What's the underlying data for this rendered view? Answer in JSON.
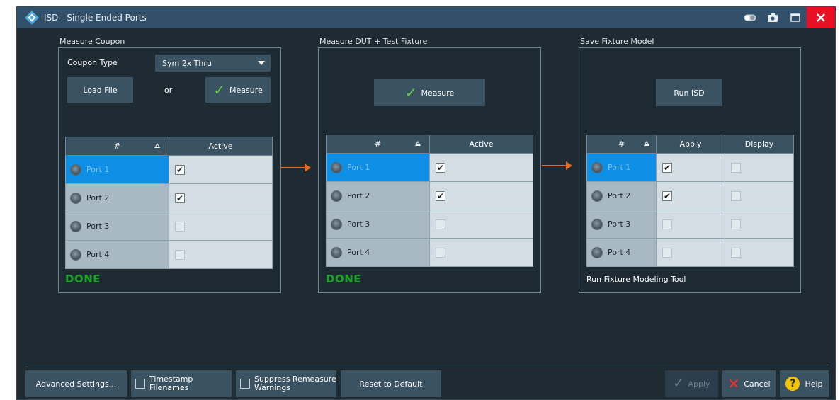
{
  "window": {
    "title": "ISD - Single Ended Ports",
    "colors": {
      "titlebar": "#33506b",
      "background": "#1f2b33",
      "button": "#3a5262",
      "accent_done": "#19a526",
      "flow_arrow": "#e86a1f",
      "selected_row": "#0d8fe5",
      "close": "#e81123"
    }
  },
  "titlebar_icons": [
    "toggle-icon",
    "camera-icon",
    "maximize-icon",
    "close-icon"
  ],
  "measure_coupon": {
    "group_label": "Measure Coupon",
    "coupon_type_label": "Coupon Type",
    "coupon_type_value": "Sym 2x Thru",
    "load_file_label": "Load File",
    "or_label": "or",
    "measure_label": "Measure",
    "table": {
      "headers": [
        "#",
        "Active"
      ],
      "rows": [
        {
          "port": "Port 1",
          "active": true,
          "selected": true
        },
        {
          "port": "Port 2",
          "active": true,
          "selected": false
        },
        {
          "port": "Port 3",
          "active": false,
          "selected": false
        },
        {
          "port": "Port 4",
          "active": false,
          "selected": false
        }
      ]
    },
    "status": "DONE"
  },
  "measure_dut": {
    "group_label": "Measure DUT + Test Fixture",
    "measure_label": "Measure",
    "table": {
      "headers": [
        "#",
        "Active"
      ],
      "rows": [
        {
          "port": "Port 1",
          "active": true,
          "selected": true
        },
        {
          "port": "Port 2",
          "active": true,
          "selected": false
        },
        {
          "port": "Port 3",
          "active": false,
          "selected": false
        },
        {
          "port": "Port 4",
          "active": false,
          "selected": false
        }
      ]
    },
    "status": "DONE"
  },
  "save_fixture": {
    "group_label": "Save Fixture Model",
    "run_isd_label": "Run ISD",
    "table": {
      "headers": [
        "#",
        "Apply",
        "Display"
      ],
      "rows": [
        {
          "port": "Port 1",
          "apply": true,
          "display": false,
          "selected": true
        },
        {
          "port": "Port 2",
          "apply": true,
          "display": false,
          "selected": false
        },
        {
          "port": "Port 3",
          "apply": false,
          "display": false,
          "selected": false
        },
        {
          "port": "Port 4",
          "apply": false,
          "display": false,
          "selected": false
        }
      ]
    },
    "note": "Run Fixture Modeling Tool"
  },
  "footer": {
    "advanced_settings": "Advanced Settings...",
    "timestamp_line1": "Timestamp",
    "timestamp_line2": "Filenames",
    "suppress_line1": "Suppress Remeasure",
    "suppress_line2": "Warnings",
    "reset_default": "Reset to Default",
    "apply": "Apply",
    "cancel": "Cancel",
    "help": "Help"
  }
}
